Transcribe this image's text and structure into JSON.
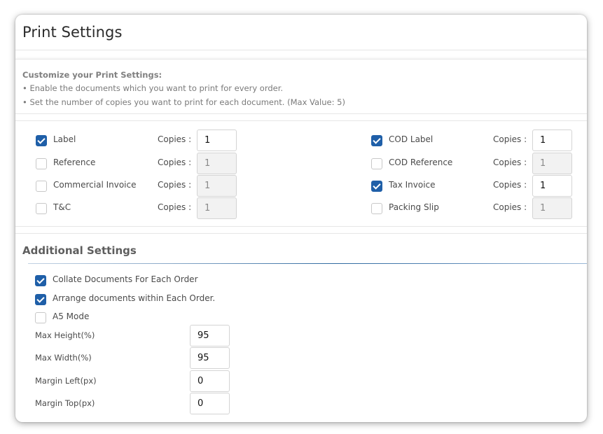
{
  "header": {
    "title": "Print Settings"
  },
  "instructions": {
    "heading": "Customize your Print Settings:",
    "lines": [
      "• Enable the documents which you want to print for every order.",
      "• Set the number of copies you want to print for each document. (Max Value: 5)"
    ]
  },
  "documents": {
    "copies_label": "Copies :",
    "left": [
      {
        "label": "Label",
        "checked": true,
        "copies": "1"
      },
      {
        "label": "Reference",
        "checked": false,
        "copies": "1"
      },
      {
        "label": "Commercial Invoice",
        "checked": false,
        "copies": "1"
      },
      {
        "label": "T&C",
        "checked": false,
        "copies": "1"
      }
    ],
    "right": [
      {
        "label": "COD Label",
        "checked": true,
        "copies": "1"
      },
      {
        "label": "COD Reference",
        "checked": false,
        "copies": "1"
      },
      {
        "label": "Tax Invoice",
        "checked": true,
        "copies": "1"
      },
      {
        "label": "Packing Slip",
        "checked": false,
        "copies": "1"
      }
    ]
  },
  "additional": {
    "title": "Additional Settings",
    "options": [
      {
        "label": "Collate Documents For Each Order",
        "checked": true
      },
      {
        "label": "Arrange documents within Each Order.",
        "checked": true
      },
      {
        "label": "A5 Mode",
        "checked": false
      }
    ],
    "fields": [
      {
        "label": "Max Height(%)",
        "value": "95"
      },
      {
        "label": "Max Width(%)",
        "value": "95"
      },
      {
        "label": "Margin Left(px)",
        "value": "0"
      },
      {
        "label": "Margin Top(px)",
        "value": "0"
      }
    ]
  },
  "colors": {
    "accent": "#1f5fa8",
    "disabled_input_bg": "#f2f2f2"
  }
}
